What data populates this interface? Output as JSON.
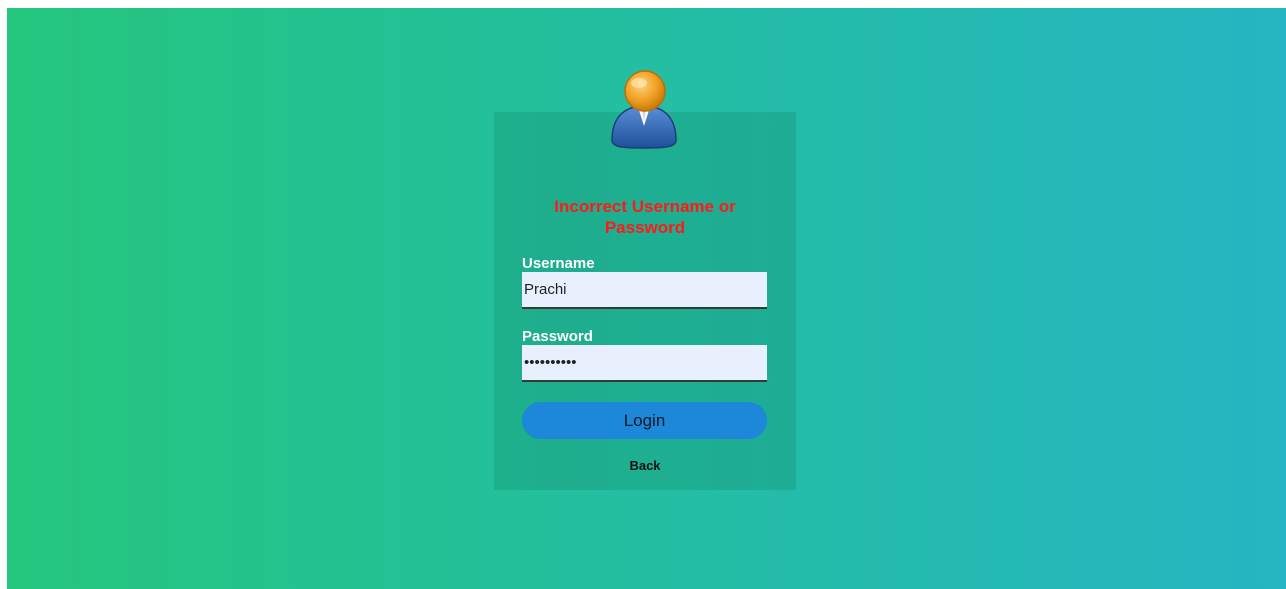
{
  "login": {
    "error_line1": "Incorrect Username or",
    "error_line2": "Password",
    "username_label": "Username",
    "username_value": "Prachi",
    "password_label": "Password",
    "password_value": "••••••••••",
    "login_label": "Login",
    "back_label": "Back"
  },
  "icons": {
    "avatar": "user-avatar-icon"
  },
  "colors": {
    "gradient_start": "#25c67d",
    "gradient_end": "#24b6c2",
    "error": "#ff1a1a",
    "button": "#1d88d9",
    "input_bg": "#e8f0fe"
  }
}
